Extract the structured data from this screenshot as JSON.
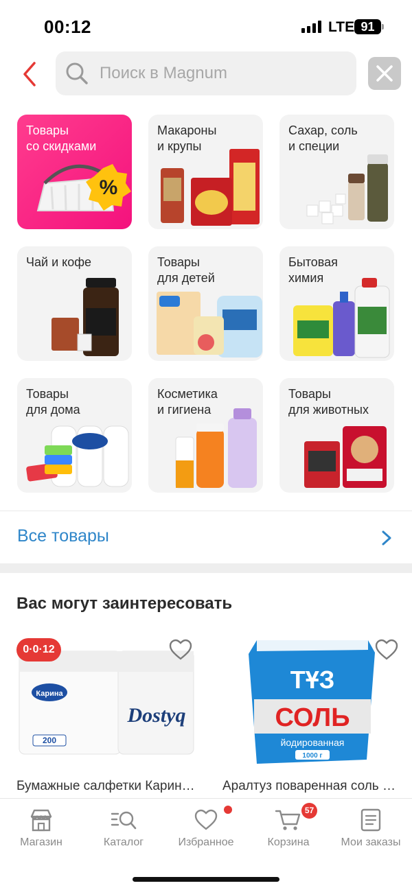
{
  "status_bar": {
    "time": "00:12",
    "network": "LTE",
    "battery": "91"
  },
  "search": {
    "placeholder": "Поиск в Magnum"
  },
  "categories": [
    {
      "label": "Товары\nсо скидками"
    },
    {
      "label": "Макароны\nи крупы"
    },
    {
      "label": "Сахар, соль\nи специи"
    },
    {
      "label": "Чай и кофе"
    },
    {
      "label": "Товары\nдля детей"
    },
    {
      "label": "Бытовая\nхимия"
    },
    {
      "label": "Товары\nдля дома"
    },
    {
      "label": "Косметика\nи гигиена"
    },
    {
      "label": "Товары\nдля животных"
    }
  ],
  "all_goods": {
    "label": "Все товары"
  },
  "recommend": {
    "title": "Вас могут заинтересовать"
  },
  "products": [
    {
      "name": "Бумажные салфетки Карина Dostyq",
      "timer_badge": "0·0·12",
      "brand_text": "Dostyq",
      "logo_text": "Карина",
      "pack_text": "200"
    },
    {
      "name": "Аралтуз поваренная соль йодированная",
      "pack_big_text": "ТҰЗ",
      "pack_text_2": "СОЛЬ",
      "pack_sub": "йодированная",
      "pack_weight": "1000 г"
    }
  ],
  "tabs": [
    {
      "label": "Магазин",
      "icon": "store-icon"
    },
    {
      "label": "Каталог",
      "icon": "catalog-search-icon"
    },
    {
      "label": "Избранное",
      "icon": "heart-icon"
    },
    {
      "label": "Корзина",
      "icon": "cart-icon",
      "badge": "57"
    },
    {
      "label": "Мои заказы",
      "icon": "orders-icon"
    }
  ],
  "colors": {
    "accent_blue": "#2f86c9",
    "promo_pink": "#f4127d",
    "badge_red": "#e53935",
    "back_red": "#e53935"
  }
}
